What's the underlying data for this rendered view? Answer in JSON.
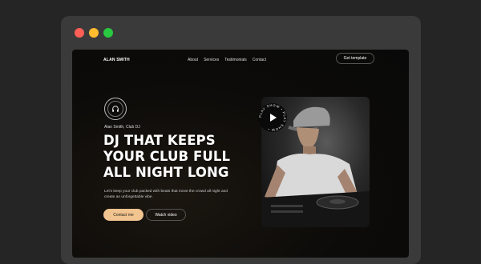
{
  "site": {
    "brand": "ALAN SMITH",
    "nav": [
      "About",
      "Services",
      "Testimonials",
      "Contact"
    ],
    "cta_top": "Get template"
  },
  "hero": {
    "subtitle": "Alan Smith, Club DJ",
    "headline_lines": [
      "DJ THAT KEEPS",
      "YOUR CLUB FULL",
      "ALL NIGHT LONG"
    ],
    "description": "Let's keep your club packed with beats that move the crowd all night and create an unforgettable vibe.",
    "primary_button": "Contact me",
    "secondary_button": "Watch video"
  },
  "badge_text": "PLAY SHOW • PLAY SHOW •",
  "icons": {
    "logo": "headphones-icon",
    "play": "play-icon"
  },
  "colors": {
    "accent": "#f2c48f",
    "bg": "#0c0b09",
    "frame": "#3a3a3a"
  }
}
